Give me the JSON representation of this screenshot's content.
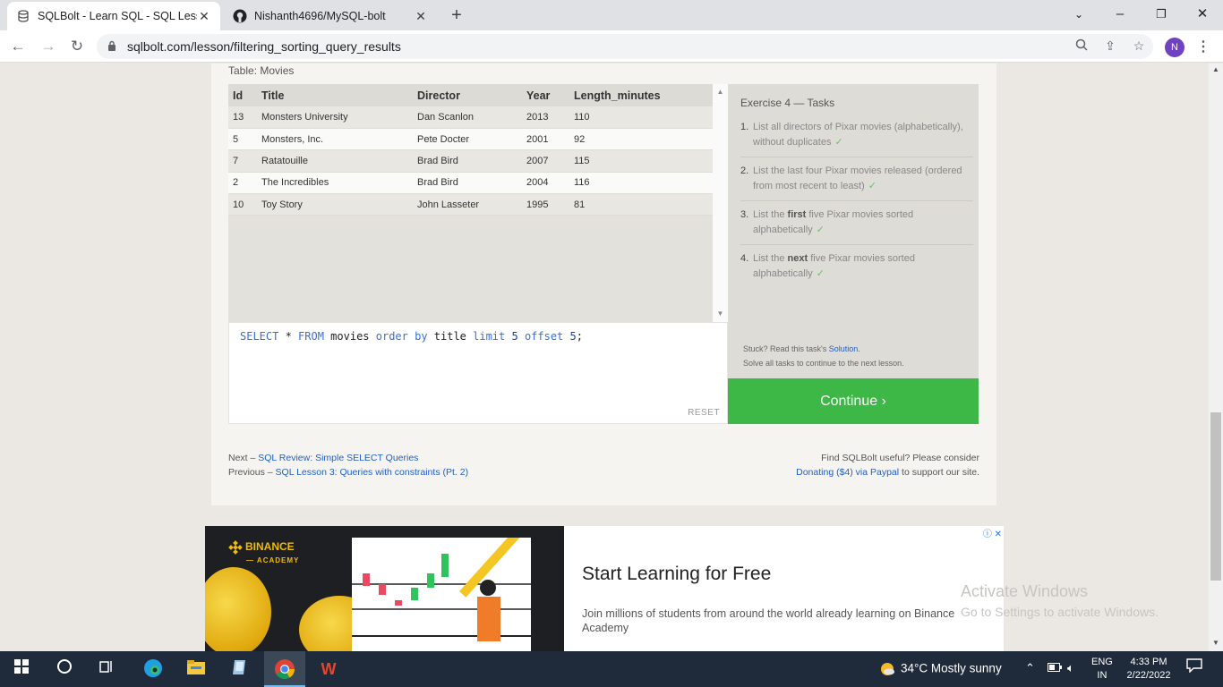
{
  "browser": {
    "tabs": [
      {
        "title": "SQLBolt - Learn SQL - SQL Lesson",
        "active": true
      },
      {
        "title": "Nishanth4696/MySQL-bolt",
        "active": false
      }
    ],
    "new_tab": "+",
    "url": "sqlbolt.com/lesson/filtering_sorting_query_results",
    "profile_initial": "N"
  },
  "lesson": {
    "table_label": "Table: Movies",
    "columns": [
      "Id",
      "Title",
      "Director",
      "Year",
      "Length_minutes"
    ],
    "rows": [
      [
        "13",
        "Monsters University",
        "Dan Scanlon",
        "2013",
        "110"
      ],
      [
        "5",
        "Monsters, Inc.",
        "Pete Docter",
        "2001",
        "92"
      ],
      [
        "7",
        "Ratatouille",
        "Brad Bird",
        "2007",
        "115"
      ],
      [
        "2",
        "The Incredibles",
        "Brad Bird",
        "2004",
        "116"
      ],
      [
        "10",
        "Toy Story",
        "John Lasseter",
        "1995",
        "81"
      ]
    ],
    "query": {
      "select": "SELECT",
      "star": " * ",
      "from": "FROM",
      "table": " movies ",
      "order": "order by",
      "col": " title ",
      "limit": "limit",
      "limit_n": " 5 ",
      "offset": "offset",
      "offset_n": " 5",
      "end": ";"
    },
    "reset_label": "RESET",
    "tasks_header": "Exercise 4 — Tasks",
    "tasks": [
      {
        "num": "1.",
        "text": "List all directors of Pixar movies (alphabetically), without duplicates"
      },
      {
        "num": "2.",
        "text": "List the last four Pixar movies released (ordered from most recent to least)"
      },
      {
        "num": "3.",
        "pre": "List the ",
        "bold": "first",
        "post": " five Pixar movies sorted alphabetically"
      },
      {
        "num": "4.",
        "pre": "List the ",
        "bold": "next",
        "post": " five Pixar movies sorted alphabetically"
      }
    ],
    "check": "✓",
    "stuck_text": "Stuck? Read this task's ",
    "solution_link": "Solution",
    "stuck_end": ".",
    "solve_text": "Solve all tasks to continue to the next lesson.",
    "continue_label": "Continue ›",
    "next_prefix": "Next – ",
    "next_link": "SQL Review: Simple SELECT Queries",
    "prev_prefix": "Previous – ",
    "prev_link": "SQL Lesson 3: Queries with constraints (Pt. 2)",
    "useful_text": "Find SQLBolt useful? Please consider",
    "donate_link": "Donating ($4) via Paypal",
    "donate_end": " to support our site."
  },
  "ad": {
    "brand": "BINANCE",
    "brand_sub": "— ACADEMY",
    "title": "Start Learning for Free",
    "description": "Join millions of students from around the world already learning on Binance Academy",
    "ad_marker": "ⓘ ✕"
  },
  "watermark": {
    "line1": "Activate Windows",
    "line2": "Go to Settings to activate Windows."
  },
  "taskbar": {
    "weather": "34°C  Mostly sunny",
    "lang_top": "ENG",
    "lang_bottom": "IN",
    "time": "4:33 PM",
    "date": "2/22/2022"
  },
  "colors": {
    "continue": "#3db847",
    "link": "#2260c6",
    "keyword": "#3a6fd6",
    "binance": "#f0b90b"
  }
}
